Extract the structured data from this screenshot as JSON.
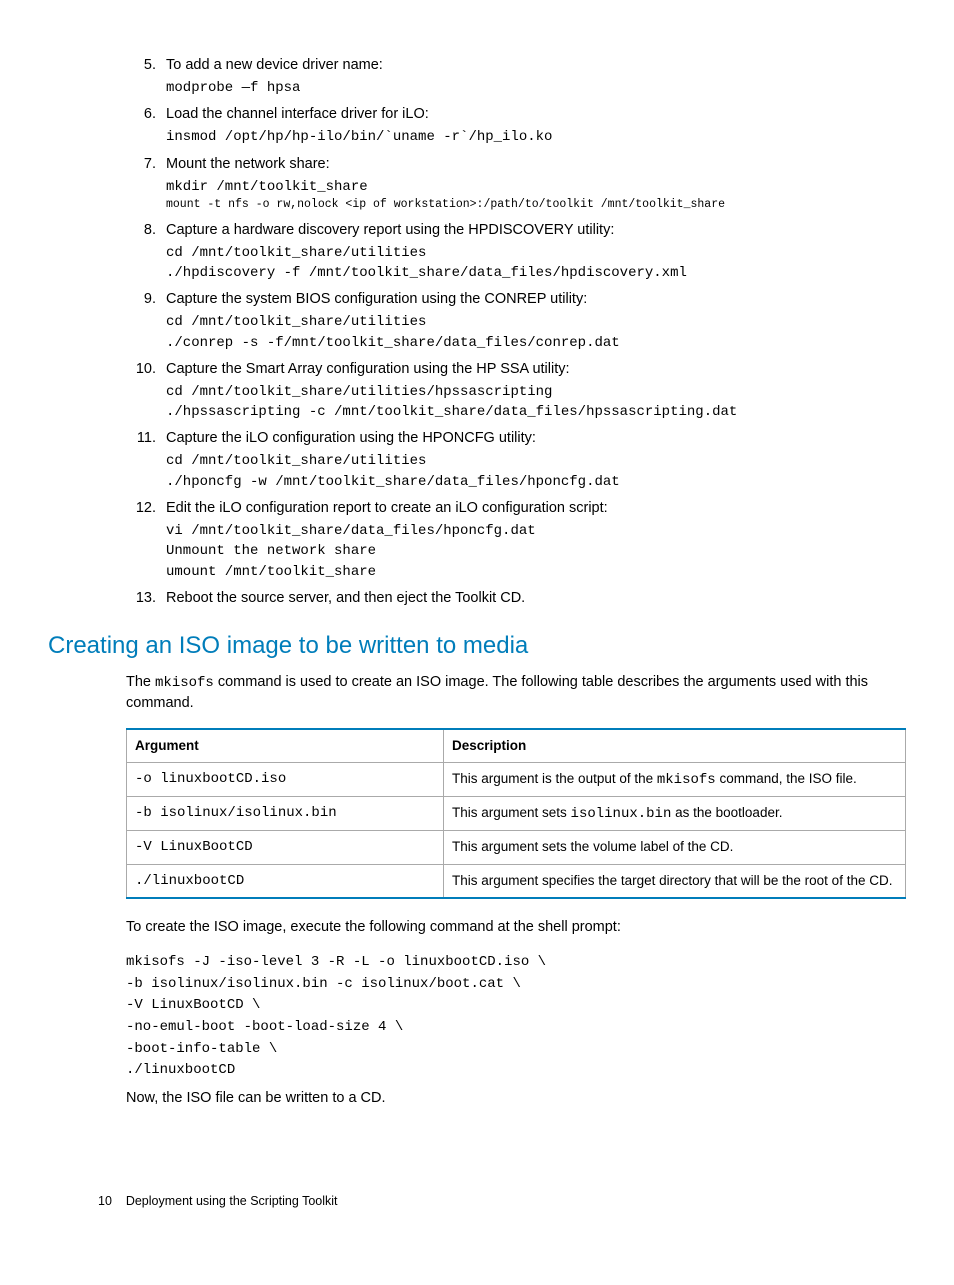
{
  "steps": [
    {
      "num": "5.",
      "text": "To add a new device driver name:",
      "code": "modprobe —f hpsa"
    },
    {
      "num": "6.",
      "text": "Load the channel interface driver for iLO:",
      "code": "insmod /opt/hp/hp-ilo/bin/`uname -r`/hp_ilo.ko"
    },
    {
      "num": "7.",
      "text": "Mount the network share:",
      "code": "mkdir /mnt/toolkit_share",
      "code_small": "mount -t nfs -o rw,nolock <ip of workstation>:/path/to/toolkit /mnt/toolkit_share"
    },
    {
      "num": "8.",
      "text": "Capture a hardware discovery report using the HPDISCOVERY utility:",
      "code": "cd /mnt/toolkit_share/utilities\n./hpdiscovery -f /mnt/toolkit_share/data_files/hpdiscovery.xml"
    },
    {
      "num": "9.",
      "text": "Capture the system BIOS configuration using the CONREP utility:",
      "code": "cd /mnt/toolkit_share/utilities\n./conrep -s -f/mnt/toolkit_share/data_files/conrep.dat"
    },
    {
      "num": "10.",
      "text": "Capture the Smart Array configuration using the HP SSA utility:",
      "code": "cd /mnt/toolkit_share/utilities/hpssascripting\n./hpssascripting -c /mnt/toolkit_share/data_files/hpssascripting.dat"
    },
    {
      "num": "11.",
      "text": "Capture the iLO configuration using the HPONCFG utility:",
      "code": "cd /mnt/toolkit_share/utilities\n./hponcfg -w /mnt/toolkit_share/data_files/hponcfg.dat"
    },
    {
      "num": "12.",
      "text": "Edit the iLO configuration report to create an iLO configuration script:",
      "code": "vi /mnt/toolkit_share/data_files/hponcfg.dat\nUnmount the network share\numount /mnt/toolkit_share"
    },
    {
      "num": "13.",
      "text": "Reboot the source server, and then eject the Toolkit CD."
    }
  ],
  "section_heading": "Creating an ISO image to be written to media",
  "intro_a": "The ",
  "intro_code": "mkisofs",
  "intro_b": " command is used to create an ISO image. The following table describes the arguments used with this command.",
  "table": {
    "head": {
      "c1": "Argument",
      "c2": "Description"
    },
    "rows": [
      {
        "arg": "-o linuxbootCD.iso",
        "desc_a": "This argument is the output of the ",
        "desc_code": "mkisofs",
        "desc_b": " command, the ISO file."
      },
      {
        "arg": "-b isolinux/isolinux.bin",
        "desc_a": "This argument sets ",
        "desc_code": "isolinux.bin",
        "desc_b": " as the bootloader."
      },
      {
        "arg": "-V LinuxBootCD",
        "desc_a": "This argument sets the volume label of the CD.",
        "desc_code": "",
        "desc_b": ""
      },
      {
        "arg": "./linuxbootCD",
        "desc_a": "This argument specifies the target directory that will be the root of the CD.",
        "desc_code": "",
        "desc_b": ""
      }
    ]
  },
  "post_table_text": "To create the ISO image, execute the following command at the shell prompt:",
  "iso_command": "mkisofs -J -iso-level 3 -R -L -o linuxbootCD.iso \\\n-b isolinux/isolinux.bin -c isolinux/boot.cat \\\n-V LinuxBootCD \\\n-no-emul-boot -boot-load-size 4 \\\n-boot-info-table \\\n./linuxbootCD",
  "closing": "Now, the ISO file can be written to a CD.",
  "footer": {
    "page": "10",
    "title": "Deployment using the Scripting Toolkit"
  }
}
